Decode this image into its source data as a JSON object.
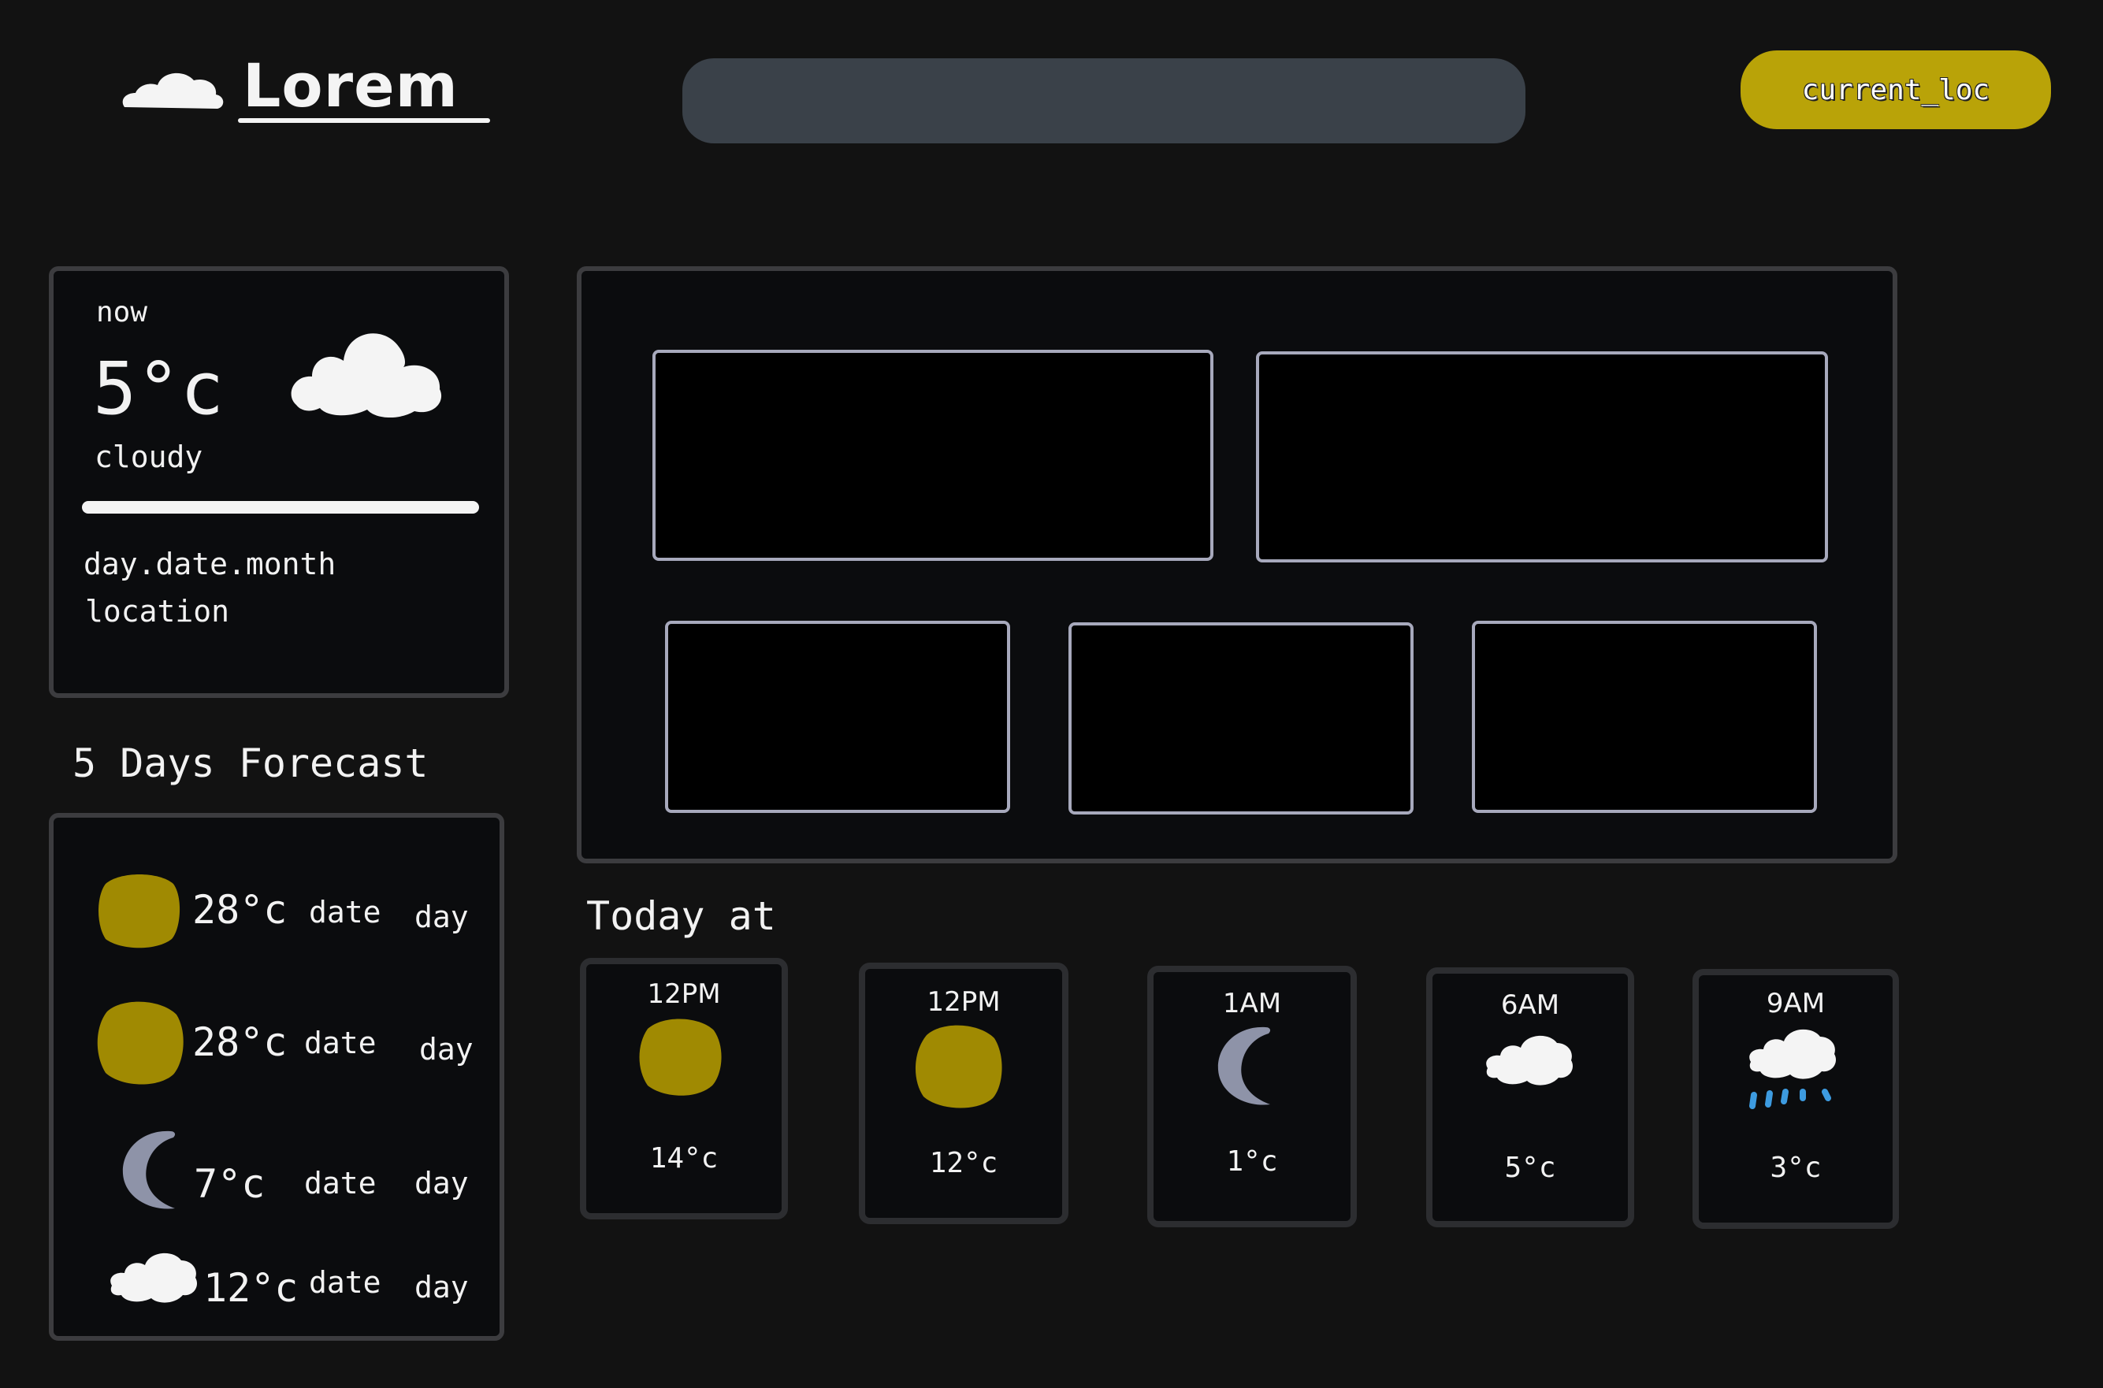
{
  "header": {
    "logo_text": "Lorem",
    "search_value": "",
    "location_button_label": "current_loc"
  },
  "current": {
    "label": "now",
    "temperature": "5°c",
    "icon": "cloud-icon",
    "condition": "cloudy",
    "date": "day.date.month",
    "location": "location"
  },
  "forecast": {
    "title": "5 Days Forecast",
    "items": [
      {
        "icon": "sun-icon",
        "temp": "28°c",
        "date": "date",
        "day": "day"
      },
      {
        "icon": "sun-icon",
        "temp": "28°c",
        "date": "date",
        "day": "day"
      },
      {
        "icon": "moon-icon",
        "temp": "7°c",
        "date": "date",
        "day": "day"
      },
      {
        "icon": "cloud-icon",
        "temp": "12°c",
        "date": "date",
        "day": "day"
      }
    ]
  },
  "today": {
    "title": "Today at",
    "hours": [
      {
        "time": "12PM",
        "icon": "sun-icon",
        "temp": "14°c"
      },
      {
        "time": "12PM",
        "icon": "sun-icon",
        "temp": "12°c"
      },
      {
        "time": "1AM",
        "icon": "moon-icon",
        "temp": "1°c"
      },
      {
        "time": "6AM",
        "icon": "cloud-icon",
        "temp": "5°c"
      },
      {
        "time": "9AM",
        "icon": "rain-cloud-icon",
        "temp": "3°c"
      }
    ]
  },
  "colors": {
    "background": "#121212",
    "accent_yellow": "#b9a308",
    "sun": "#a08a02",
    "moon": "#8e93a8",
    "rain": "#3d9be0",
    "search_bg": "#3a4149",
    "box_border": "#a7a9bc"
  }
}
